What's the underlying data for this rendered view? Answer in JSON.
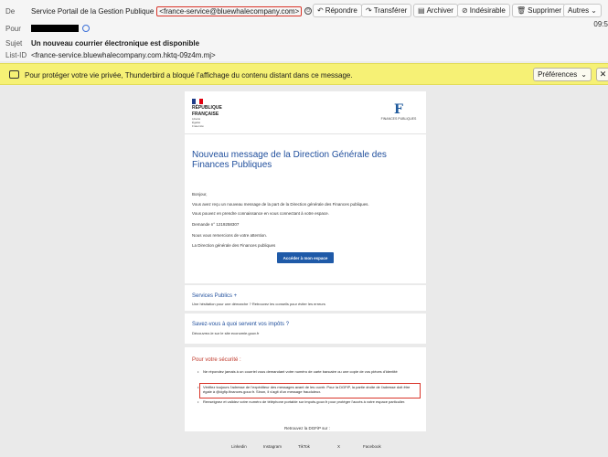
{
  "header": {
    "from_label": "De",
    "from_name": "Service Portail de la Gestion Publique",
    "from_address": "<france-service@bluewhalecompany.com>",
    "to_label": "Pour",
    "subject_label": "Sujet",
    "subject": "Un nouveau courrier électronique est disponible",
    "listid_label": "List-ID",
    "listid": "<france-service.bluewhalecompany.com.hktq-09z4m.mj>",
    "time": "09:5"
  },
  "toolbar": {
    "reply": "Répondre",
    "forward": "Transférer",
    "archive": "Archiver",
    "junk": "Indésirable",
    "delete": "Supprimer",
    "more": "Autres"
  },
  "banner": {
    "text": "Pour protéger votre vie privée, Thunderbird a bloqué l’affichage du contenu distant dans ce message.",
    "prefs": "Préférences",
    "close": "✕"
  },
  "email": {
    "rf_line1": "RÉPUBLIQUE",
    "rf_line2": "FRANÇAISE",
    "rf_motto1": "Liberté",
    "rf_motto2": "Égalité",
    "rf_motto3": "Fraternité",
    "fp_text": "FINANCES PUBLIQUES",
    "title": "Nouveau message de la Direction Générale des Finances Publiques",
    "greeting": "Bonjour,",
    "p1": "Vous avez reçu un nouveau message de la part de la Direction générale des Finances publiques.",
    "p2": "Vous pouvez en prendre connaissance en vous connectant à votre espace.",
    "request": "Demande n° 1219258307",
    "thanks": "Nous vous remercions de votre attention.",
    "signature": "La Direction générale des Finances publiques",
    "button": "Accéder à mon espace",
    "sp_title": "Services Publics +",
    "sp_text": "Une hésitation pour une démarche ? Retrouvez les conseils pour éviter les erreurs",
    "taxes_title": "Savez-vous à quoi servent vos impôts ?",
    "taxes_text": "Découvrez-le sur le site economie.gouv.fr",
    "sec_title": "Pour votre sécurité :",
    "sec1": "Ne répondez jamais à un courriel vous demandant votre numéro de carte bancaire ou une copie de vos pièces d'identité",
    "sec2": "Vérifiez toujours l'adresse de l'expéditeur des messages avant de les ouvrir. Pour la DGFiP, la partie droite de l'adresse doit être égale à @dgfip.finances.gouv.fr. Sinon, il s'agit d'un message frauduleux.",
    "sec3": "Renseignez et validez votre numéro de téléphone portable sur impots.gouv.fr pour protéger l'accès à votre espace particulier.",
    "follow": "Retrouvez la DGFiP sur :",
    "social": [
      "Linkedin",
      "Instagram",
      "TikTok",
      "X",
      "Facebook"
    ]
  }
}
